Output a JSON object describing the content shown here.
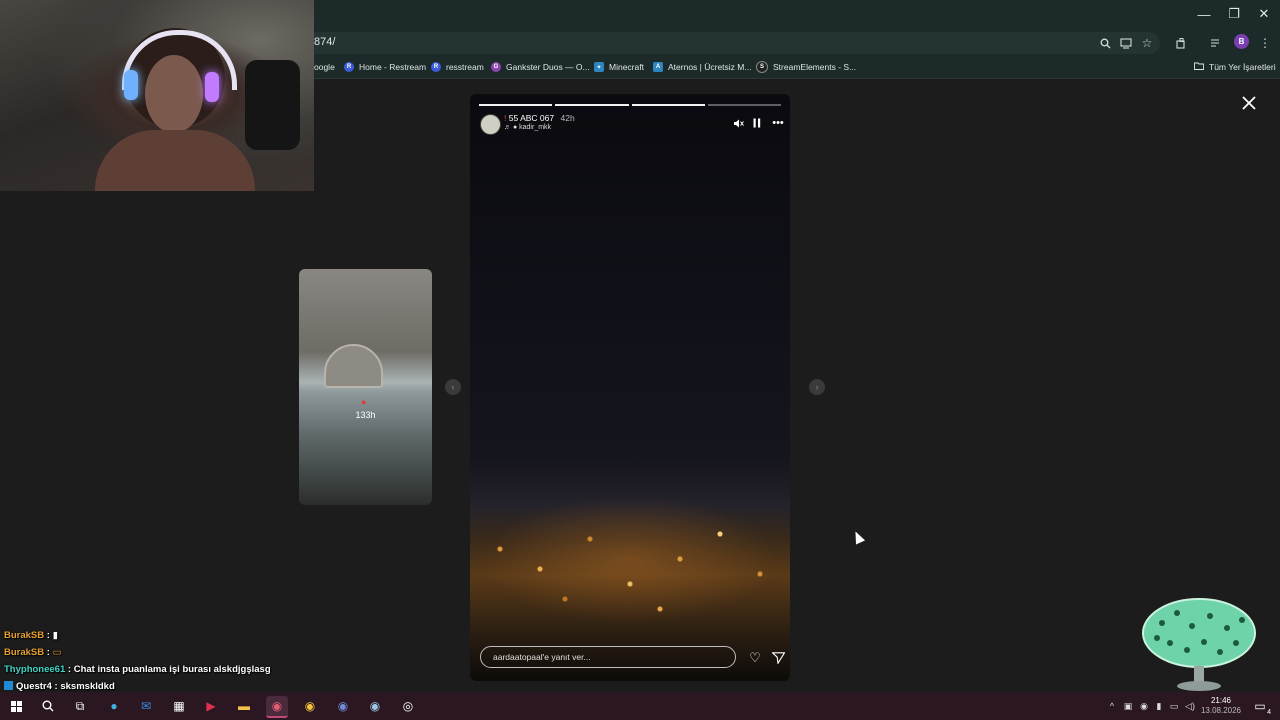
{
  "browser": {
    "url_fragment": "874/",
    "window_controls": {
      "minimize": "—",
      "restore": "❐",
      "close": "✕"
    },
    "bookmarks": [
      {
        "label": "oogle",
        "icon": "google-icon",
        "color": ""
      },
      {
        "label": "Home - Restream",
        "icon": "restream-icon",
        "color": "#3b5bdb"
      },
      {
        "label": "resstream",
        "icon": "restream-icon",
        "color": "#3b5bdb"
      },
      {
        "label": "Gankster Duos — O...",
        "icon": "gankster-icon",
        "color": "#8e44ad"
      },
      {
        "label": "Minecraft",
        "icon": "minecraft-icon",
        "color": "#2e86c1"
      },
      {
        "label": "Aternos | Ücretsiz M...",
        "icon": "aternos-icon",
        "color": "#2e86c1"
      },
      {
        "label": "StreamElements - S...",
        "icon": "streamelements-icon",
        "color": "#222222"
      }
    ],
    "all_bookmarks_label": "Tüm Yer İşaretleri",
    "profile_initial": "B"
  },
  "story": {
    "username": "55 ABC 067",
    "time_ago": "42h",
    "subtitle": "kadir_mkk",
    "reply_placeholder": "aardaatopaal'e yanıt ver...",
    "progress_segments": 4,
    "progress_done": 2
  },
  "side_story": {
    "time_ago": "133h"
  },
  "chat": [
    {
      "user": "BurakSB",
      "sep": " : ",
      "msg": "▮",
      "color": "#e8a030"
    },
    {
      "user": "BurakSB",
      "sep": " : ",
      "msg": "▭",
      "color": "#e8a030"
    },
    {
      "user": "Thyphonee61",
      "sep": " : ",
      "msg": "Chat insta puanlama işi burası alskdjgşlasg",
      "color": "#3fd6c6"
    },
    {
      "user": "Questr4",
      "sep": " : ",
      "msg": "sksmskldkd",
      "color": "#ffffff"
    }
  ],
  "taskbar": {
    "time": "21:46",
    "date": "13.08.2026",
    "notification_count": "4"
  },
  "colors": {
    "accent": "#c04b7a",
    "chrome_bg": "#1c2b2a",
    "page_bg": "#1c1c1c"
  }
}
